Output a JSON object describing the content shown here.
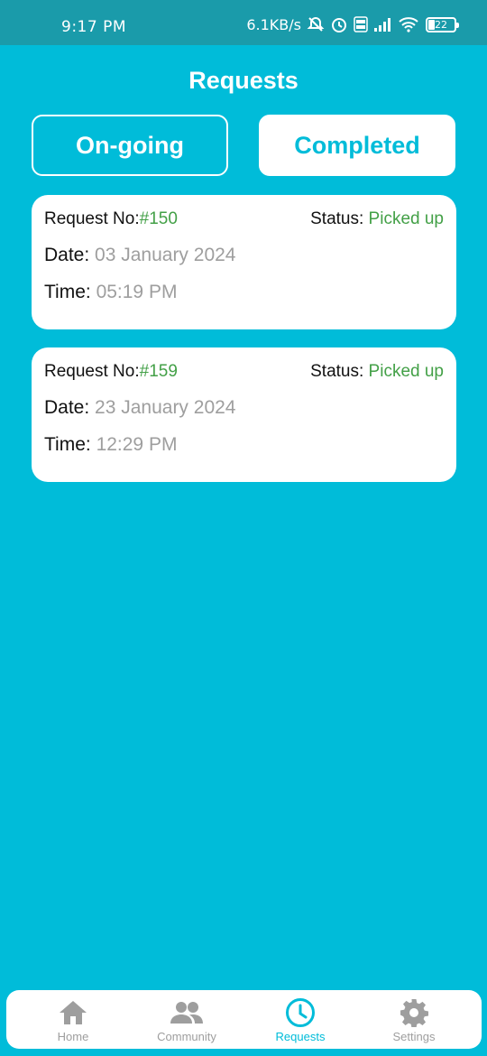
{
  "status_bar": {
    "time": "9:17 PM",
    "net_speed": "6.1KB/s",
    "battery": "22"
  },
  "header": {
    "title": "Requests"
  },
  "tabs": {
    "ongoing": "On-going",
    "completed": "Completed",
    "selected": "Completed"
  },
  "labels": {
    "request_no": "Request No:",
    "status": "Status: ",
    "date": "Date: ",
    "time": "Time: "
  },
  "requests": [
    {
      "number": "#150",
      "status": "Picked up",
      "date": "03 January 2024",
      "time": "05:19 PM"
    },
    {
      "number": "#159",
      "status": "Picked up",
      "date": "23 January 2024",
      "time": "12:29 PM"
    }
  ],
  "bottom_nav": {
    "items": [
      {
        "label": "Home",
        "icon": "home-icon"
      },
      {
        "label": "Community",
        "icon": "people-icon"
      },
      {
        "label": "Requests",
        "icon": "clock-icon"
      },
      {
        "label": "Settings",
        "icon": "gear-icon"
      }
    ],
    "active": "Requests"
  },
  "colors": {
    "background": "#00BCD9",
    "status_bar": "#1A9BAA",
    "accent_green": "#43A047",
    "muted_grey": "#9E9E9E"
  }
}
